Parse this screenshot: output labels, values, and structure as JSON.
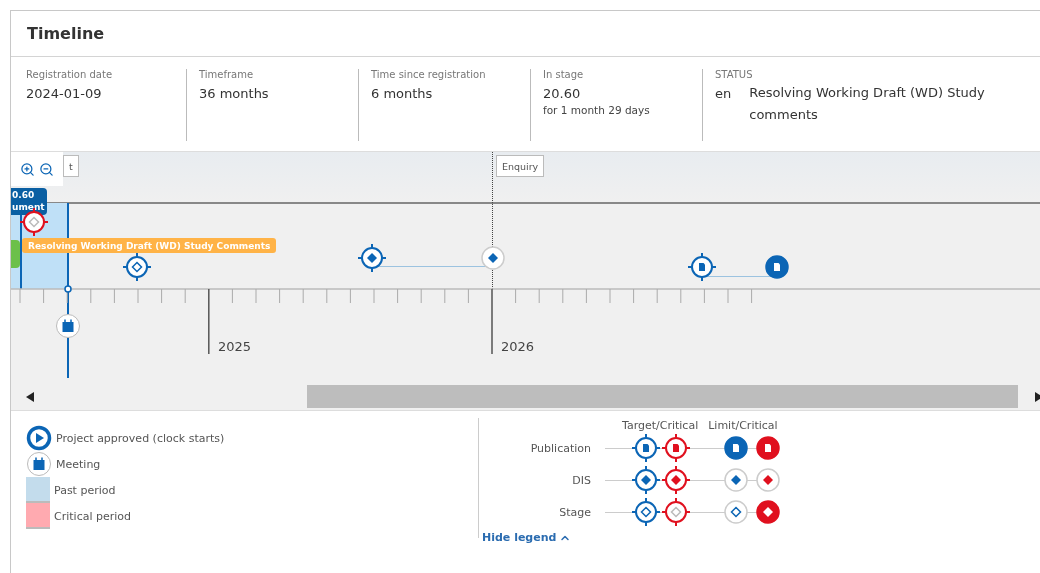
{
  "panel": {
    "title": "Timeline"
  },
  "summary": [
    {
      "label": "Registration date",
      "value": "2024-01-09"
    },
    {
      "label": "Timeframe",
      "value": "36 months"
    },
    {
      "label": "Time since registration",
      "value": "6 months"
    },
    {
      "label": "In stage",
      "value": "20.60",
      "note": "for 1 month 29 days"
    }
  ],
  "status": {
    "label": "STATUS",
    "language": "en",
    "value": "Resolving Working Draft (WD) Study comments"
  },
  "timeline": {
    "stage_labels": [
      "t",
      "Enquiry"
    ],
    "current_badge": [
      "0.60",
      "ument"
    ],
    "stage_tag": "Resolving Working Draft (WD) Study Comments",
    "markers": [
      {
        "kind": "target_stage",
        "critical": true
      },
      {
        "kind": "target_stage",
        "critical": false
      },
      {
        "kind": "target_dis",
        "critical": false
      },
      {
        "kind": "limit_dis",
        "critical": false
      },
      {
        "kind": "target_publication",
        "critical": false
      },
      {
        "kind": "limit_publication",
        "critical": false
      }
    ],
    "years": [
      "2025",
      "2026"
    ]
  },
  "legend": {
    "items": [
      {
        "kind": "approved",
        "label": "Project approved (clock starts)"
      },
      {
        "kind": "meeting",
        "label": "Meeting"
      },
      {
        "kind": "past",
        "label": "Past period"
      },
      {
        "kind": "critical",
        "label": "Critical period"
      }
    ],
    "columns": [
      "Target/Critical",
      "Limit/Critical"
    ],
    "rows": [
      {
        "label": "Publication",
        "kind": "publication"
      },
      {
        "label": "DIS",
        "kind": "dis"
      },
      {
        "label": "Stage",
        "kind": "stage"
      }
    ],
    "toggle": "Hide legend"
  }
}
